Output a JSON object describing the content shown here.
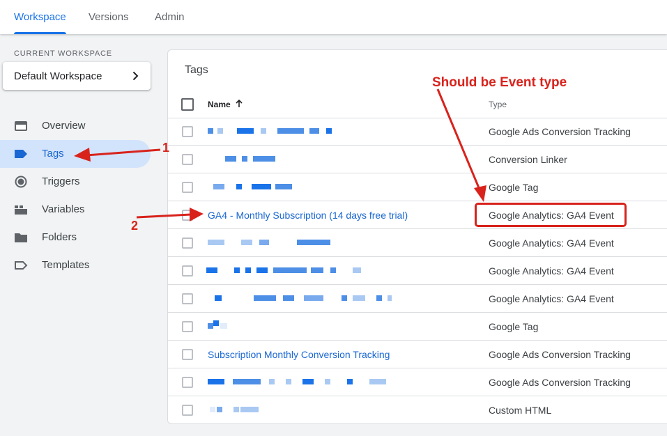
{
  "topbar": {
    "tabs": [
      {
        "label": "Workspace",
        "active": true
      },
      {
        "label": "Versions",
        "active": false
      },
      {
        "label": "Admin",
        "active": false
      }
    ]
  },
  "sidebar": {
    "workspace_label": "CURRENT WORKSPACE",
    "workspace_name": "Default Workspace",
    "items": [
      {
        "label": "Overview",
        "icon": "overview-icon",
        "active": false
      },
      {
        "label": "Tags",
        "icon": "tag-icon",
        "active": true
      },
      {
        "label": "Triggers",
        "icon": "trigger-icon",
        "active": false
      },
      {
        "label": "Variables",
        "icon": "variables-icon",
        "active": false
      },
      {
        "label": "Folders",
        "icon": "folder-icon",
        "active": false
      },
      {
        "label": "Templates",
        "icon": "template-icon",
        "active": false
      }
    ]
  },
  "tags_table": {
    "title": "Tags",
    "columns": {
      "name": "Name",
      "type": "Type"
    },
    "rows": [
      {
        "name": "",
        "type": "Google Ads Conversion Tracking",
        "redacted": true
      },
      {
        "name": "",
        "type": "Conversion Linker",
        "redacted": true
      },
      {
        "name": "",
        "type": "Google Tag",
        "redacted": true
      },
      {
        "name": "GA4 - Monthly Subscription (14 days free trial)",
        "type": "Google Analytics: GA4 Event",
        "redacted": false
      },
      {
        "name": "",
        "type": "Google Analytics: GA4 Event",
        "redacted": true
      },
      {
        "name": "",
        "type": "Google Analytics: GA4 Event",
        "redacted": true
      },
      {
        "name": "",
        "type": "Google Analytics: GA4 Event",
        "redacted": true
      },
      {
        "name": "",
        "type": "Google Tag",
        "redacted": true
      },
      {
        "name": "Subscription Monthly Conversion Tracking",
        "type": "Google Ads Conversion Tracking",
        "redacted": false
      },
      {
        "name": "",
        "type": "Google Ads Conversion Tracking",
        "redacted": true
      },
      {
        "name": "",
        "type": "Custom HTML",
        "redacted": true
      }
    ]
  },
  "annotations": {
    "note": "Should be Event type",
    "marker_1": "1",
    "marker_2": "2",
    "color": "#d8231c"
  }
}
